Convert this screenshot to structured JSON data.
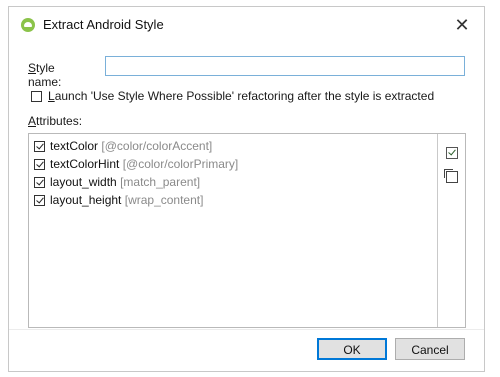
{
  "window": {
    "title": "Extract Android Style",
    "close_glyph": "✕",
    "icon": "android-studio-icon"
  },
  "form": {
    "style_name_label_accel": "S",
    "style_name_label_rest": "tyle name:",
    "style_name_value": "",
    "launch_checked": false,
    "launch_label_accel": "L",
    "launch_label_rest": "aunch 'Use Style Where Possible' refactoring after the style is extracted",
    "attributes_label_accel": "A",
    "attributes_label_rest": "ttributes:"
  },
  "attributes": [
    {
      "name": "textColor",
      "value": "[@color/colorAccent]",
      "checked": true
    },
    {
      "name": "textColorHint",
      "value": "[@color/colorPrimary]",
      "checked": true
    },
    {
      "name": "layout_width",
      "value": "[match_parent]",
      "checked": true
    },
    {
      "name": "layout_height",
      "value": "[wrap_content]",
      "checked": true
    }
  ],
  "side_buttons": [
    {
      "icon": "check-all-icon"
    },
    {
      "icon": "uncheck-all-icon"
    }
  ],
  "buttons": {
    "ok": "OK",
    "cancel": "Cancel"
  },
  "colors": {
    "focus_border": "#0078d7",
    "input_border": "#7ab0d9",
    "value_text": "#8a8a8a"
  }
}
